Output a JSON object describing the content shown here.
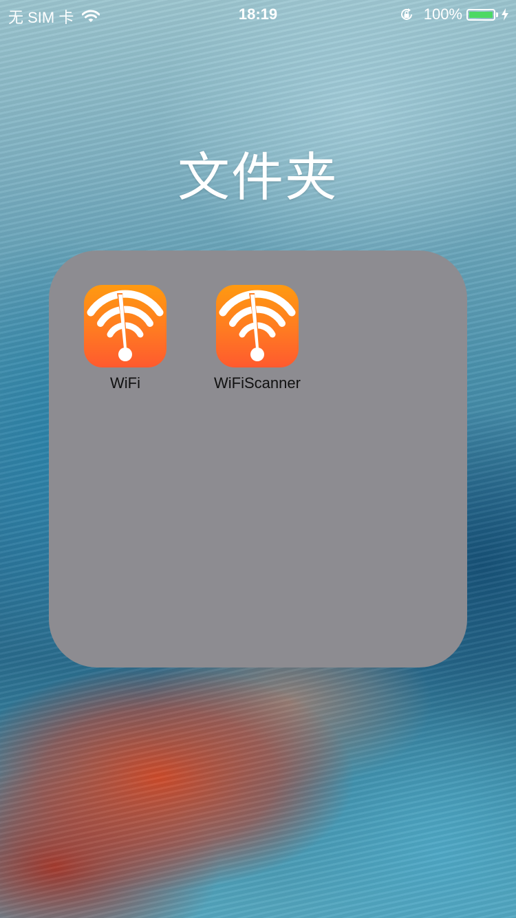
{
  "status_bar": {
    "carrier": "无 SIM 卡",
    "time": "18:19",
    "battery_percent": "100%",
    "battery_level": 1.0,
    "battery_color": "#4cd964",
    "wifi_icon": "wifi-icon",
    "rotation_lock_icon": "rotation-lock-icon",
    "charging_icon": "charging-bolt-icon"
  },
  "folder": {
    "title": "文件夹",
    "background_color": "#8d8c91",
    "apps": [
      {
        "label": "WiFi",
        "icon": "wifi-app-icon"
      },
      {
        "label": "WiFiScanner",
        "icon": "wifi-scanner-app-icon"
      }
    ]
  }
}
